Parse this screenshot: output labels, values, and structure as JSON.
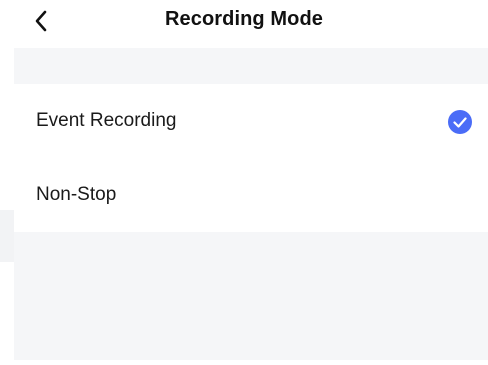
{
  "header": {
    "title": "Recording Mode",
    "back_icon": "chevron-left-icon"
  },
  "options": {
    "items": [
      {
        "label": "Event Recording",
        "selected": true
      },
      {
        "label": "Non-Stop",
        "selected": false
      }
    ],
    "check_icon": "check-circle-icon"
  },
  "colors": {
    "accent": "#4a6cf7",
    "page_background": "#ffffff",
    "band_background": "#f5f6f8",
    "text": "#1a1a1a"
  }
}
